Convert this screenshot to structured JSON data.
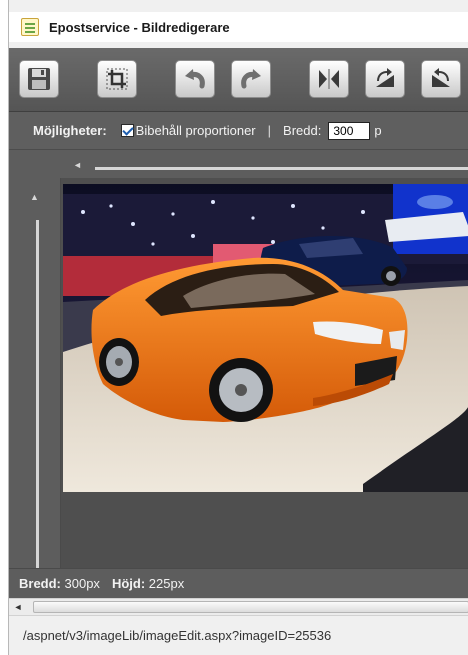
{
  "window": {
    "title": "Epostservice - Bildredigerare",
    "icon": "document-icon"
  },
  "toolbar": {
    "buttons": [
      {
        "name": "save",
        "icon": "floppy-disk-icon"
      },
      {
        "name": "crop",
        "icon": "crop-icon"
      },
      {
        "name": "undo",
        "icon": "undo-icon"
      },
      {
        "name": "redo",
        "icon": "redo-icon"
      },
      {
        "name": "flip-horizontal",
        "icon": "flip-horizontal-icon"
      },
      {
        "name": "rotate-left",
        "icon": "rotate-left-icon"
      },
      {
        "name": "rotate-right",
        "icon": "rotate-right-icon"
      }
    ]
  },
  "options": {
    "label": "Möjligheter:",
    "keep_proportions_label": "Bibehåll proportioner",
    "keep_proportions_checked": true,
    "separator": "|",
    "width_label": "Bredd:",
    "width_value": "300",
    "width_unit_partial": "p"
  },
  "image": {
    "description_icon": "car-photo",
    "subject": "orange hatchback"
  },
  "size_info": {
    "width_label": "Bredd:",
    "width_value": "300px",
    "height_label": "Höjd:",
    "height_value": "225px"
  },
  "status": {
    "url": "/aspnet/v3/imageLib/imageEdit.aspx?imageID=25536"
  },
  "colors": {
    "editor_bg": "#5d5d5d",
    "accent_orange": "#f07a1a"
  }
}
